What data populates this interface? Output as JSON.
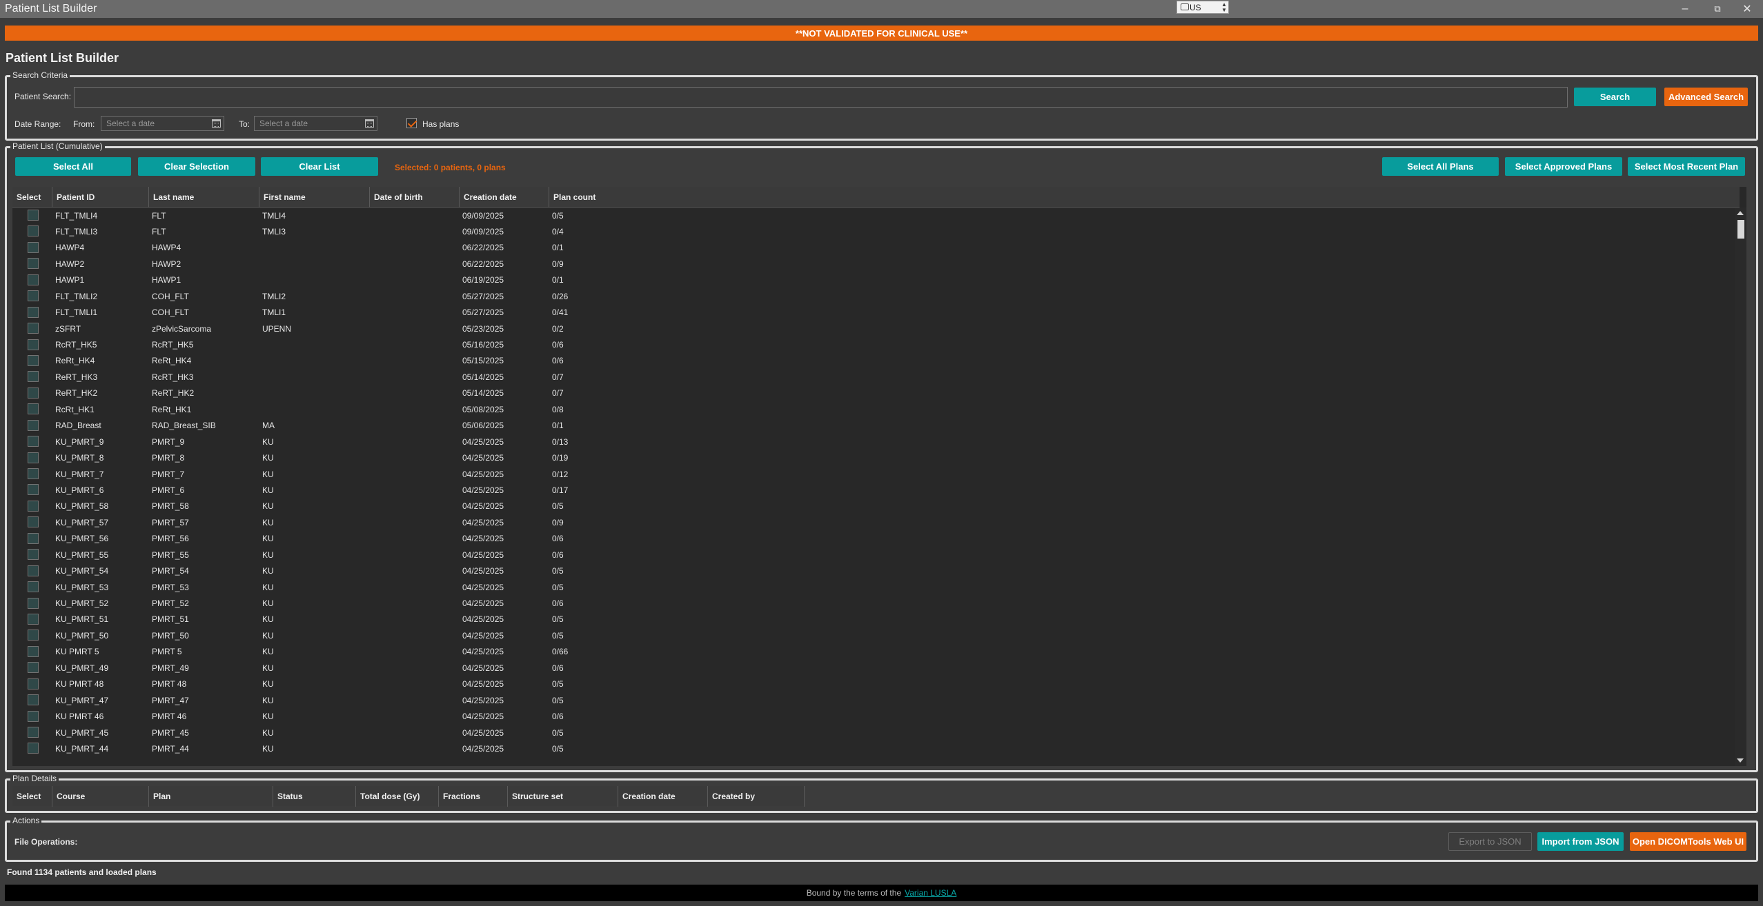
{
  "window": {
    "title": "Patient List Builder",
    "language": "US",
    "controls": [
      "minimize-icon",
      "restore-icon",
      "close-icon"
    ]
  },
  "banner": "**NOT VALIDATED FOR CLINICAL USE**",
  "page_title": "Patient List Builder",
  "search": {
    "group_label": "Search Criteria",
    "patient_search_label": "Patient Search:",
    "patient_search_value": "",
    "date_range_label": "Date Range:",
    "from_label": "From:",
    "from_placeholder": "Select a date",
    "to_label": "To:",
    "to_placeholder": "Select a date",
    "has_plans_label": "Has plans",
    "has_plans_checked": true,
    "search_button": "Search",
    "advanced_button": "Advanced Search"
  },
  "patient_list": {
    "group_label": "Patient List (Cumulative)",
    "select_all": "Select All",
    "clear_selection": "Clear Selection",
    "clear_list": "Clear List",
    "selected_text": "Selected: 0 patients, 0 plans",
    "select_all_plans": "Select All Plans",
    "select_approved_plans": "Select Approved Plans",
    "select_most_recent_plan": "Select Most Recent Plan",
    "columns": [
      "Select",
      "Patient ID",
      "Last name",
      "First name",
      "Date of birth",
      "Creation date",
      "Plan count"
    ],
    "rows": [
      [
        "FLT_TMLI4",
        "FLT",
        "TMLI4",
        "",
        "09/09/2025",
        "0/5"
      ],
      [
        "FLT_TMLI3",
        "FLT",
        "TMLI3",
        "",
        "09/09/2025",
        "0/4"
      ],
      [
        "HAWP4",
        "HAWP4",
        "",
        "",
        "06/22/2025",
        "0/1"
      ],
      [
        "HAWP2",
        "HAWP2",
        "",
        "",
        "06/22/2025",
        "0/9"
      ],
      [
        "HAWP1",
        "HAWP1",
        "",
        "",
        "06/19/2025",
        "0/1"
      ],
      [
        "FLT_TMLI2",
        "COH_FLT",
        "TMLI2",
        "",
        "05/27/2025",
        "0/26"
      ],
      [
        "FLT_TMLI1",
        "COH_FLT",
        "TMLI1",
        "",
        "05/27/2025",
        "0/41"
      ],
      [
        "zSFRT",
        "zPelvicSarcoma",
        "UPENN",
        "",
        "05/23/2025",
        "0/2"
      ],
      [
        "RcRT_HK5",
        "RcRT_HK5",
        "",
        "",
        "05/16/2025",
        "0/6"
      ],
      [
        "ReRt_HK4",
        "ReRt_HK4",
        "",
        "",
        "05/15/2025",
        "0/6"
      ],
      [
        "ReRT_HK3",
        "RcRT_HK3",
        "",
        "",
        "05/14/2025",
        "0/7"
      ],
      [
        "ReRT_HK2",
        "ReRT_HK2",
        "",
        "",
        "05/14/2025",
        "0/7"
      ],
      [
        "RcRt_HK1",
        "ReRt_HK1",
        "",
        "",
        "05/08/2025",
        "0/8"
      ],
      [
        "RAD_Breast",
        "RAD_Breast_SIB",
        "MA",
        "",
        "05/06/2025",
        "0/1"
      ],
      [
        "KU_PMRT_9",
        "PMRT_9",
        "KU",
        "",
        "04/25/2025",
        "0/13"
      ],
      [
        "KU_PMRT_8",
        "PMRT_8",
        "KU",
        "",
        "04/25/2025",
        "0/19"
      ],
      [
        "KU_PMRT_7",
        "PMRT_7",
        "KU",
        "",
        "04/25/2025",
        "0/12"
      ],
      [
        "KU_PMRT_6",
        "PMRT_6",
        "KU",
        "",
        "04/25/2025",
        "0/17"
      ],
      [
        "KU_PMRT_58",
        "PMRT_58",
        "KU",
        "",
        "04/25/2025",
        "0/5"
      ],
      [
        "KU_PMRT_57",
        "PMRT_57",
        "KU",
        "",
        "04/25/2025",
        "0/9"
      ],
      [
        "KU_PMRT_56",
        "PMRT_56",
        "KU",
        "",
        "04/25/2025",
        "0/6"
      ],
      [
        "KU_PMRT_55",
        "PMRT_55",
        "KU",
        "",
        "04/25/2025",
        "0/6"
      ],
      [
        "KU_PMRT_54",
        "PMRT_54",
        "KU",
        "",
        "04/25/2025",
        "0/5"
      ],
      [
        "KU_PMRT_53",
        "PMRT_53",
        "KU",
        "",
        "04/25/2025",
        "0/5"
      ],
      [
        "KU_PMRT_52",
        "PMRT_52",
        "KU",
        "",
        "04/25/2025",
        "0/6"
      ],
      [
        "KU_PMRT_51",
        "PMRT_51",
        "KU",
        "",
        "04/25/2025",
        "0/5"
      ],
      [
        "KU_PMRT_50",
        "PMRT_50",
        "KU",
        "",
        "04/25/2025",
        "0/5"
      ],
      [
        "KU PMRT 5",
        "PMRT 5",
        "KU",
        "",
        "04/25/2025",
        "0/66"
      ],
      [
        "KU_PMRT_49",
        "PMRT_49",
        "KU",
        "",
        "04/25/2025",
        "0/6"
      ],
      [
        "KU PMRT 48",
        "PMRT 48",
        "KU",
        "",
        "04/25/2025",
        "0/5"
      ],
      [
        "KU_PMRT_47",
        "PMRT_47",
        "KU",
        "",
        "04/25/2025",
        "0/5"
      ],
      [
        "KU PMRT 46",
        "PMRT 46",
        "KU",
        "",
        "04/25/2025",
        "0/6"
      ],
      [
        "KU_PMRT_45",
        "PMRT_45",
        "KU",
        "",
        "04/25/2025",
        "0/5"
      ],
      [
        "KU_PMRT_44",
        "PMRT_44",
        "KU",
        "",
        "04/25/2025",
        "0/5"
      ]
    ]
  },
  "plan_details": {
    "group_label": "Plan Details",
    "columns": [
      "Select",
      "Course",
      "Plan",
      "Status",
      "Total dose (Gy)",
      "Fractions",
      "Structure set",
      "Creation date",
      "Created by"
    ]
  },
  "actions": {
    "group_label": "Actions",
    "file_operations_label": "File Operations:",
    "export_json": "Export to JSON",
    "import_json": "Import from JSON",
    "open_web_ui": "Open DICOMTools Web UI"
  },
  "status_text": "Found 1134 patients and loaded plans",
  "footer": {
    "text": "Bound by the terms of the",
    "link": "Varian LUSLA"
  },
  "colors": {
    "accent_orange": "#e8650f",
    "accent_teal": "#089c9c",
    "background": "#3c3c3c",
    "grid_background": "#282828"
  }
}
